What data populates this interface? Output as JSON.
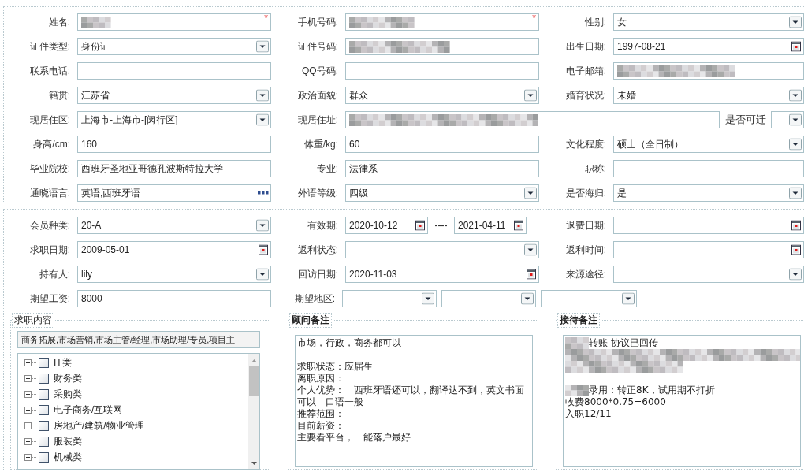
{
  "personal_info": {
    "rows": [
      {
        "kind": "standard",
        "fields": [
          {
            "label": "姓名:",
            "kind": "text",
            "redacted": true,
            "required_mark": "*"
          },
          {
            "label": "手机号码:",
            "kind": "text",
            "redacted": true,
            "required_mark": "*"
          },
          {
            "label": "性别:",
            "kind": "select",
            "value": "女"
          }
        ]
      },
      {
        "kind": "standard",
        "fields": [
          {
            "label": "证件类型:",
            "kind": "select",
            "value": "身份证"
          },
          {
            "label": "证件号码:",
            "kind": "text",
            "redacted": true
          },
          {
            "label": "出生日期:",
            "kind": "date",
            "value": "1997-08-21"
          }
        ]
      },
      {
        "kind": "standard",
        "fields": [
          {
            "label": "联系电话:",
            "kind": "text"
          },
          {
            "label": "QQ号码:",
            "kind": "text"
          },
          {
            "label": "电子邮箱:",
            "kind": "text",
            "redacted": true
          }
        ]
      },
      {
        "kind": "standard",
        "fields": [
          {
            "label": "籍贯:",
            "kind": "select",
            "value": "江苏省"
          },
          {
            "label": "政治面貌:",
            "kind": "select",
            "value": "群众"
          },
          {
            "label": "婚育状况:",
            "kind": "select",
            "value": "未婚"
          }
        ]
      },
      {
        "kind": "address",
        "fields": [
          {
            "label": "现居住区:",
            "kind": "select",
            "value": "上海市-上海市-[闵行区]"
          },
          {
            "label": "现居住址:",
            "kind": "text",
            "redacted": true
          },
          {
            "label": "是否可迁",
            "kind": "select"
          }
        ]
      },
      {
        "kind": "standard",
        "fields": [
          {
            "label": "身高/cm:",
            "kind": "text",
            "value": "160"
          },
          {
            "label": "体重/kg:",
            "kind": "text",
            "value": "60"
          },
          {
            "label": "文化程度:",
            "kind": "select",
            "value": "硕士（全日制）"
          }
        ]
      },
      {
        "kind": "standard",
        "fields": [
          {
            "label": "毕业院校:",
            "kind": "text",
            "value": "西班牙圣地亚哥德孔波斯特拉大学"
          },
          {
            "label": "专业:",
            "kind": "text",
            "value": "法律系"
          },
          {
            "label": "职称:",
            "kind": "text"
          }
        ]
      },
      {
        "kind": "standard",
        "fields": [
          {
            "label": "通晓语言:",
            "kind": "lookup",
            "value": "英语,西班牙语"
          },
          {
            "label": "外语等级:",
            "kind": "select",
            "value": "四级"
          },
          {
            "label": "是否海归:",
            "kind": "select",
            "value": "是"
          }
        ]
      }
    ]
  },
  "membership": {
    "rows": [
      {
        "kind": "standard",
        "fields": [
          {
            "label": "会员种类:",
            "kind": "select",
            "value": "20-A"
          },
          {
            "label": "有效期:",
            "kind": "date-range",
            "values": [
              "2020-10-12",
              "2021-04-11"
            ],
            "separator": "----"
          },
          {
            "label": "退费日期:",
            "kind": "date"
          }
        ]
      },
      {
        "kind": "standard",
        "fields": [
          {
            "label": "求职日期:",
            "kind": "date",
            "value": "2009-05-01"
          },
          {
            "label": "返利状态:",
            "kind": "select"
          },
          {
            "label": "返利时间:",
            "kind": "date"
          }
        ]
      },
      {
        "kind": "standard",
        "fields": [
          {
            "label": "持有人:",
            "kind": "select",
            "value": "lily"
          },
          {
            "label": "回访日期:",
            "kind": "date",
            "value": "2020-11-03"
          },
          {
            "label": "来源途径:",
            "kind": "select"
          }
        ]
      },
      {
        "kind": "region",
        "fields": [
          {
            "label": "期望工资:",
            "kind": "text",
            "value": "8000"
          },
          {
            "label": "期望地区:",
            "kind": "select-group",
            "selects": [
              {
                "kind": "select"
              },
              {
                "kind": "select"
              },
              {
                "kind": "select"
              }
            ]
          }
        ]
      }
    ]
  },
  "panels": [
    {
      "kind": "tree",
      "title": "求职内容",
      "selection": "商务拓展,市场营销,市场主管/经理,市场助理/专员,项目主",
      "items": [
        {
          "label": "IT类",
          "checked": false,
          "expanded": false
        },
        {
          "label": "财务类",
          "checked": false,
          "expanded": false
        },
        {
          "label": "采购类",
          "checked": false,
          "expanded": false
        },
        {
          "label": "电子商务/互联网",
          "checked": false,
          "expanded": false
        },
        {
          "label": "房地产/建筑/物业管理",
          "checked": false,
          "expanded": false
        },
        {
          "label": "服装类",
          "checked": false,
          "expanded": false
        },
        {
          "label": "机械类",
          "checked": false,
          "expanded": false
        }
      ]
    },
    {
      "kind": "notes",
      "title": "顾问备注",
      "lines": [
        {
          "kind": "text",
          "text": "市场，行政，商务都可以"
        },
        {
          "kind": "blank"
        },
        {
          "kind": "text",
          "text": "求职状态：应届生"
        },
        {
          "kind": "text",
          "text": "离职原因："
        },
        {
          "kind": "text",
          "text": "个人优势：　西班牙语还可以，翻译达不到，英文书面可以　口语一般"
        },
        {
          "kind": "text",
          "text": "推荐范围："
        },
        {
          "kind": "text",
          "text": "目前薪资："
        },
        {
          "kind": "text",
          "text": "主要看平台，　能落户最好"
        }
      ]
    },
    {
      "kind": "notes",
      "title": "接待备注",
      "lines": [
        {
          "kind": "text",
          "text": "转账 协议已回传",
          "redacted_prefix": true
        },
        {
          "kind": "redacted"
        },
        {
          "kind": "redacted"
        },
        {
          "kind": "blank"
        },
        {
          "kind": "text",
          "text": "录用：转正8K，试用期不打折",
          "redacted_prefix": true
        },
        {
          "kind": "text",
          "text": "收费8000*0.75=6000"
        },
        {
          "kind": "text",
          "text": "入职12/11"
        }
      ]
    }
  ]
}
